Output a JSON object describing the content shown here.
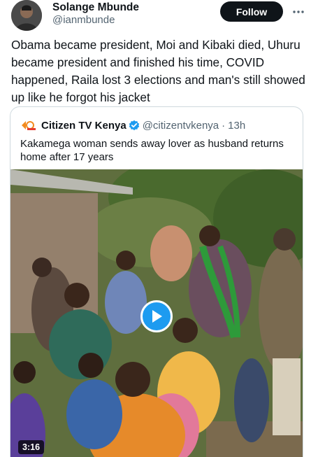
{
  "author": {
    "name": "Solange Mbunde",
    "handle": "@ianmbunde",
    "avatar_icon": "user-avatar"
  },
  "follow_label": "Follow",
  "more_icon": "more-dots-icon",
  "tweet": {
    "text": "Obama became president, Moi and Kibaki died, Uhuru became president and finished his time, COVID happened, Raila lost 3 elections and man's still showed up like he forgot his jacket"
  },
  "quoted": {
    "source_name": "Citizen TV Kenya",
    "handle": "@citizentvkenya",
    "separator": "·",
    "time": "13h",
    "verified_icon": "verified-badge-icon",
    "text": "Kakamega woman sends away lover as husband returns home after 17 years",
    "video": {
      "duration": "3:16",
      "play_icon": "play-icon"
    }
  },
  "colors": {
    "text": "#0f1419",
    "secondary": "#536471",
    "accent": "#1d9bf0",
    "follow_bg": "#0f1419",
    "border": "#cfd9de"
  }
}
